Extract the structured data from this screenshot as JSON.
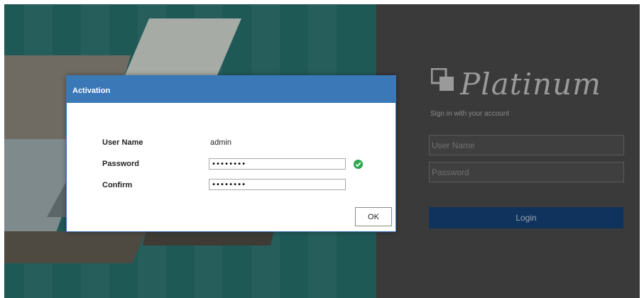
{
  "background": {
    "left_color": "#1f5956",
    "right_color": "#3a3a3a"
  },
  "brand": {
    "name": "Platinum",
    "logo_icon": "platinum-logo-icon"
  },
  "login": {
    "signin_text": "Sign in with your account",
    "username_placeholder": "User Name",
    "password_placeholder": "Password",
    "login_label": "Login"
  },
  "dialog": {
    "title": "Activation",
    "accent_color": "#3a78b8",
    "username_label": "User Name",
    "username_value": "admin",
    "password_label": "Password",
    "password_value": "••••••••",
    "confirm_label": "Confirm",
    "confirm_value": "••••••••",
    "password_status_icon": "check-circle-icon",
    "ok_label": "OK"
  }
}
